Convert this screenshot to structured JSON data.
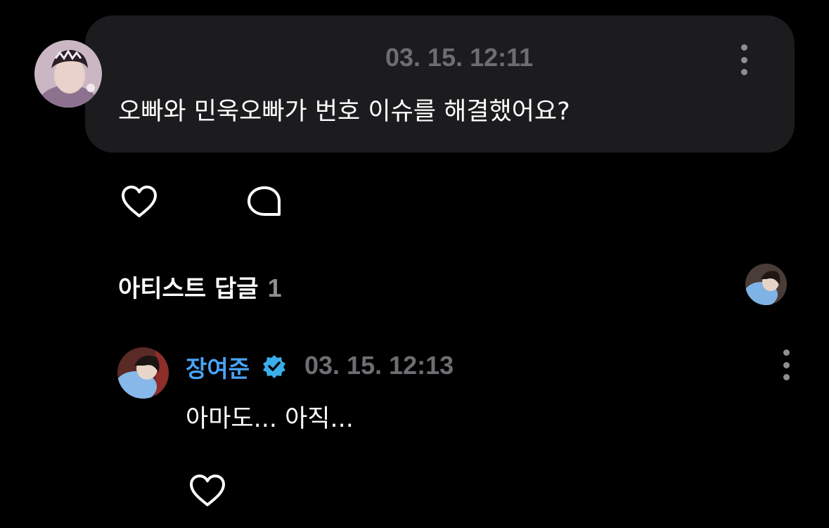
{
  "comment": {
    "timestamp": "03. 15. 12:11",
    "text": "오빠와 민욱오빠가 번호 이슈를 해결했어요?"
  },
  "artist_replies": {
    "title": "아티스트 답글",
    "count": "1"
  },
  "reply": {
    "username": "장여준",
    "verified": true,
    "timestamp": "03. 15. 12:13",
    "text": "아마도... 아직..."
  },
  "icons": {
    "like": "heart-icon",
    "comment": "speech-bubble-icon",
    "more": "kebab-menu-icon",
    "verified": "verified-badge-icon"
  },
  "colors": {
    "background": "#000000",
    "bubble": "#1c1c1e",
    "username": "#4aa3f5",
    "verified_badge": "#3aaeea",
    "timestamp": "#6d6d72"
  }
}
